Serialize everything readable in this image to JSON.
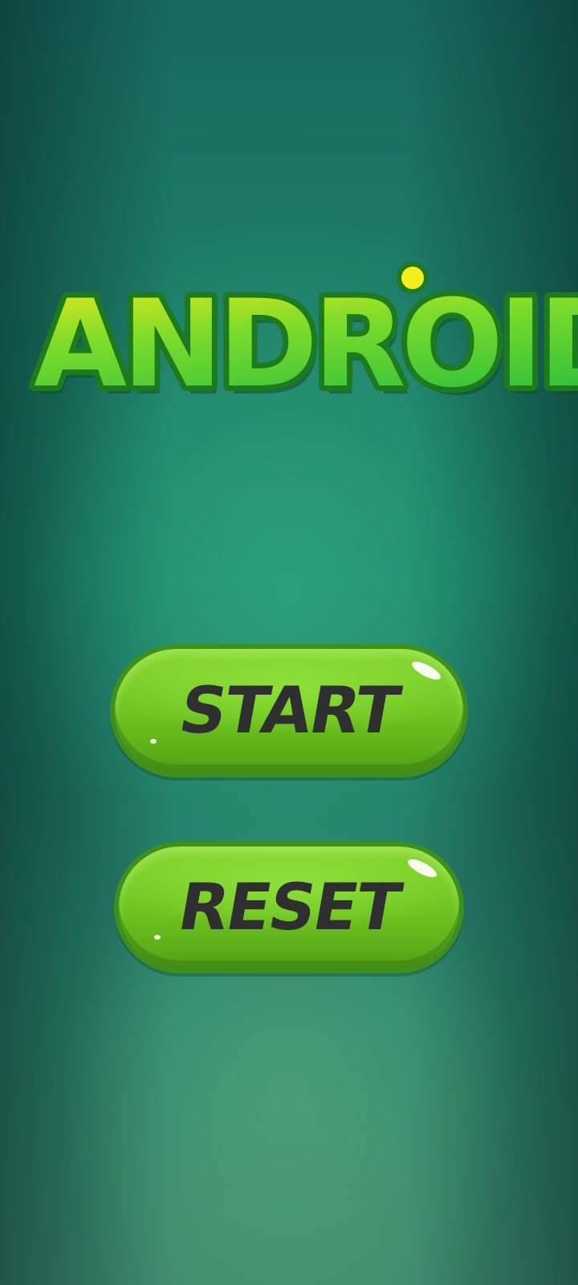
{
  "logo": {
    "text": "ANDROID",
    "fill_top": "#f2ea1c",
    "fill_bottom": "#3bc93c",
    "outline": "#1e7a1e"
  },
  "buttons": {
    "start_label": "START",
    "reset_label": "RESET"
  },
  "colors": {
    "background": "#1e8a6f",
    "button_green": "#6cc21f",
    "button_border": "#3f8f1d",
    "label_text": "#2f2f2f"
  }
}
